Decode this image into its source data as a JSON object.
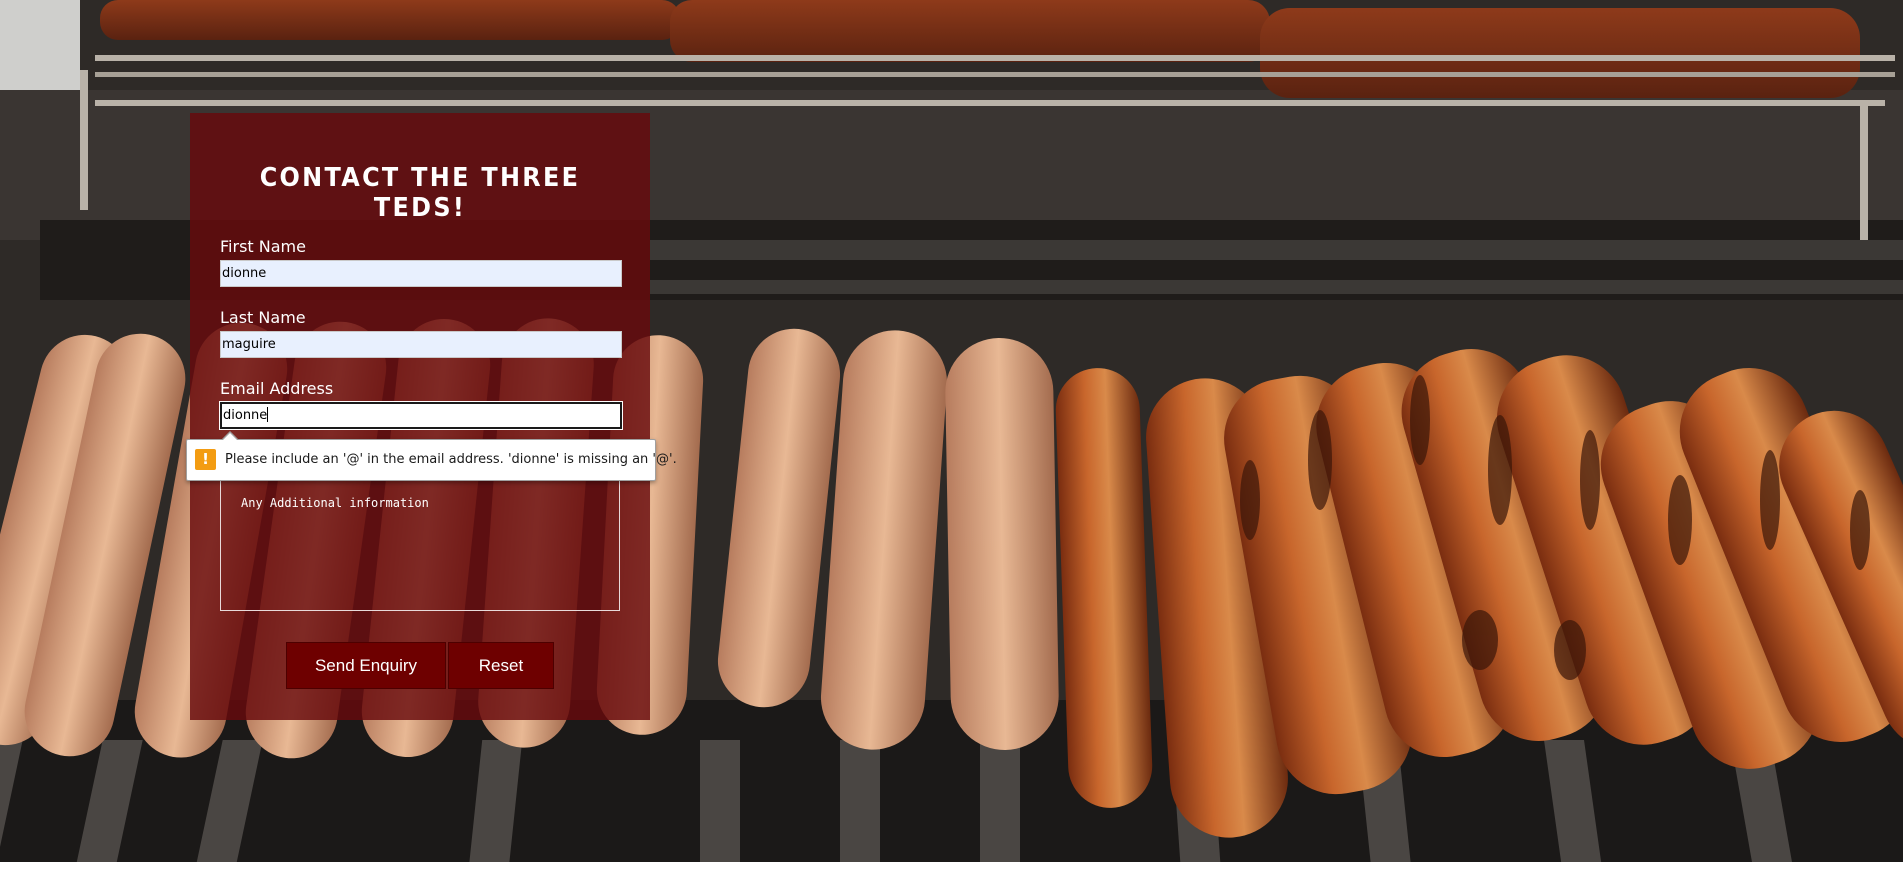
{
  "form": {
    "title": "CONTACT THE THREE TEDS!",
    "first_name": {
      "label": "First Name",
      "value": "dionne"
    },
    "last_name": {
      "label": "Last Name",
      "value": "maguire"
    },
    "email": {
      "label": "Email Address",
      "value": "dionne"
    },
    "additional_info": {
      "placeholder": "Any Additional information"
    },
    "send_label": "Send Enquiry",
    "reset_label": "Reset"
  },
  "validation": {
    "message": "Please include an '@' in the email address. 'dionne' is missing an '@'.",
    "icon": "warning-icon"
  },
  "colors": {
    "panel": "#680a0c",
    "button": "#6e0000",
    "warning": "#f39c12",
    "autofill": "#e8f0fe"
  }
}
